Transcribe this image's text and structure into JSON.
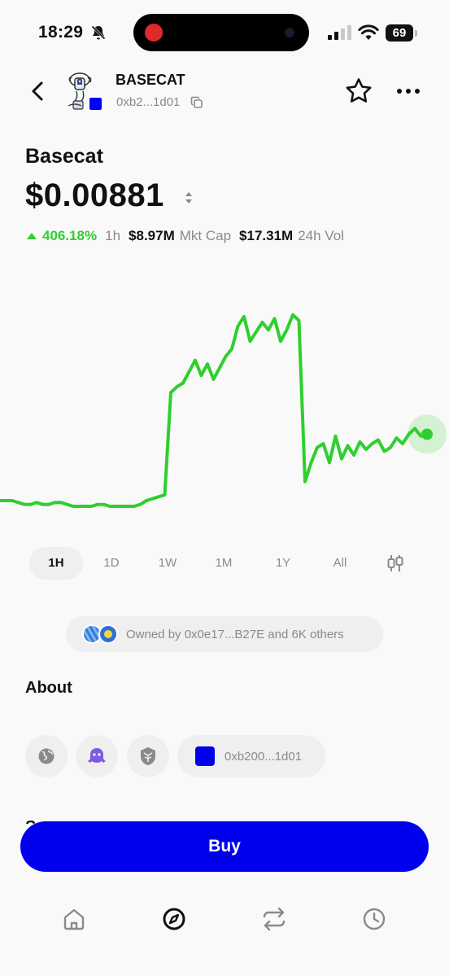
{
  "status_bar": {
    "time": "18:29",
    "battery": "69",
    "icons": [
      "bell-off-icon",
      "signal-icon",
      "wifi-icon",
      "battery-icon"
    ]
  },
  "header": {
    "token_symbol": "BASECAT",
    "address_short": "0xb2...1d01",
    "icons": [
      "back-icon",
      "copy-icon",
      "star-icon",
      "more-icon"
    ]
  },
  "token": {
    "name": "Basecat",
    "price": "$0.00881",
    "change": "406.18%",
    "change_period": "1h",
    "market_cap": "$8.97M",
    "market_cap_label": "Mkt Cap",
    "volume": "$17.31M",
    "volume_label": "24h Vol"
  },
  "colors": {
    "accent": "#0000ee",
    "positive": "#2ecf2e",
    "muted": "#8a8a8a",
    "pill_bg": "#efefef"
  },
  "price_line": {
    "period": "1H",
    "relative_level": [
      0.0,
      0.0,
      0.0,
      -0.01,
      -0.02,
      -0.02,
      -0.01,
      -0.02,
      -0.02,
      -0.01,
      -0.01,
      -0.02,
      -0.03,
      -0.03,
      -0.03,
      -0.03,
      -0.02,
      -0.02,
      -0.03,
      -0.03,
      -0.03,
      -0.03,
      -0.03,
      -0.02,
      0.0,
      0.01,
      0.02,
      0.03,
      0.57,
      0.6,
      0.62,
      0.68,
      0.74,
      0.66,
      0.72,
      0.64,
      0.7,
      0.76,
      0.8,
      0.92,
      0.97,
      0.84,
      0.89,
      0.94,
      0.9,
      0.96,
      0.84,
      0.9,
      0.98,
      0.95,
      0.1,
      0.2,
      0.28,
      0.3,
      0.2,
      0.34,
      0.22,
      0.29,
      0.24,
      0.31,
      0.27,
      0.3,
      0.32,
      0.26,
      0.28,
      0.33,
      0.3,
      0.35,
      0.38,
      0.34,
      0.35
    ]
  },
  "timeframes": [
    "1H",
    "1D",
    "1W",
    "1M",
    "1Y",
    "All"
  ],
  "active_timeframe": "1H",
  "owned": {
    "text": "Owned by 0x0e17...B27E and 6K others"
  },
  "about": {
    "title": "About",
    "links": [
      "globe-icon",
      "farcaster-icon",
      "basescan-icon"
    ],
    "contract_short": "0xb200...1d01",
    "partial_heading": "S"
  },
  "buy_label": "Buy",
  "nav": [
    "home-icon",
    "explore-icon",
    "swap-icon",
    "activity-icon"
  ]
}
